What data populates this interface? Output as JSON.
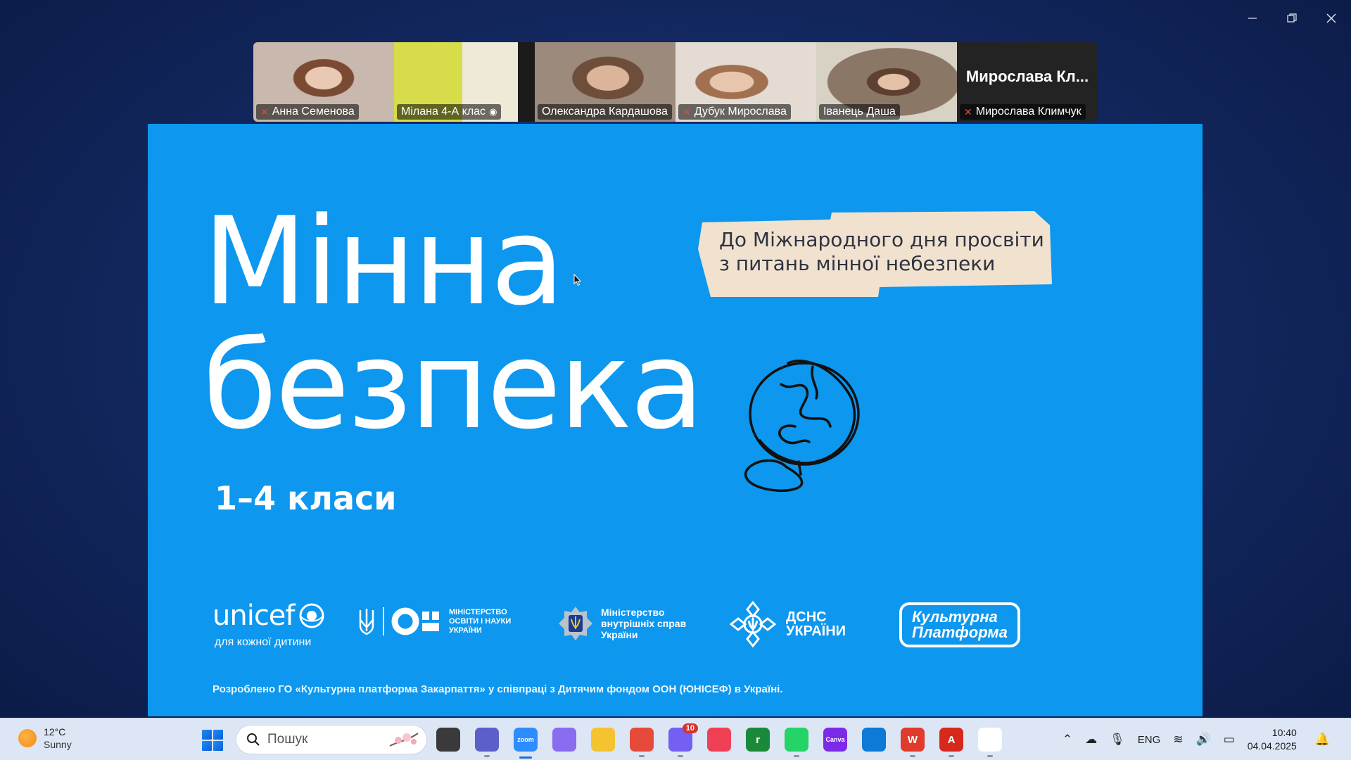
{
  "window": {
    "controls": [
      "minimize",
      "restore",
      "close"
    ]
  },
  "participants": [
    {
      "name": "Анна Семенова",
      "muted": true,
      "active": false,
      "bg": "#b9a89c"
    },
    {
      "name": "Мілана 4-А клас",
      "muted": false,
      "active": false,
      "bg": "#c7d048"
    },
    {
      "name": "Олександра Кардашова",
      "muted": false,
      "active": true,
      "bg": "#8c7466"
    },
    {
      "name": "Дубук Мирослава",
      "muted": true,
      "active": false,
      "bg": "#c9b8a8"
    },
    {
      "name": "Іванець Даша",
      "muted": false,
      "active": false,
      "bg": "#7e6a5a"
    },
    {
      "name": "Мирослава Климчук",
      "muted": true,
      "active": false,
      "display_name": "Мирослава  Кл...",
      "bg": "#232323"
    }
  ],
  "slide": {
    "title_line1": "Мінна",
    "title_line2": "безпека",
    "grades": "1–4 класи",
    "note": "До Міжнародного дня просвіти\nз питань мінної небезпеки",
    "note_line1": "До Міжнародного дня просвіти",
    "note_line2": "з питань мінної небезпеки",
    "logos": {
      "unicef": "unicef",
      "unicef_tagline": "для кожної дитини",
      "mon_line1": "Міністерство",
      "mon_line2": "освіти і науки",
      "mon_line3": "України",
      "mvs_line1": "Міністерство",
      "mvs_line2": "внутрішніх справ",
      "mvs_line3": "України",
      "dsns_line1": "ДСНС",
      "dsns_line2": "УКРАЇНИ",
      "kp_line1": "Культурна",
      "kp_line2": "Платформа"
    },
    "footer": "Розроблено ГО «Культурна платформа Закарпаття» у співпраці з Дитячим фондом ООН (ЮНІСЕФ) в Україні."
  },
  "taskbar": {
    "weather_temp": "12°C",
    "weather_cond": "Sunny",
    "search_placeholder": "Пошук",
    "apps": [
      {
        "name": "task-view",
        "color": "#3a3a3a",
        "label": ""
      },
      {
        "name": "teams-meet",
        "color": "#5b5fc7",
        "label": ""
      },
      {
        "name": "zoom",
        "color": "#2d8cff",
        "label": "zoom"
      },
      {
        "name": "copilot",
        "color": "#8a6cf0",
        "label": ""
      },
      {
        "name": "file-explorer",
        "color": "#f4c430",
        "label": ""
      },
      {
        "name": "chrome",
        "color": "#e64a3b",
        "label": ""
      },
      {
        "name": "viber",
        "color": "#7360f2",
        "label": "",
        "badge": "10"
      },
      {
        "name": "pocket",
        "color": "#ef4056",
        "label": ""
      },
      {
        "name": "rakuten",
        "color": "#1a8a3a",
        "label": "r"
      },
      {
        "name": "whatsapp",
        "color": "#25d366",
        "label": ""
      },
      {
        "name": "canva",
        "color": "#7d2ae8",
        "label": "Canva"
      },
      {
        "name": "edge",
        "color": "#0c7ad6",
        "label": ""
      },
      {
        "name": "wps-office",
        "color": "#e03b2c",
        "label": "W"
      },
      {
        "name": "acrobat",
        "color": "#d7281c",
        "label": "A"
      },
      {
        "name": "notepad",
        "color": "#2a6cd6",
        "label": ""
      }
    ],
    "language": "ENG",
    "time": "10:40",
    "date": "04.04.2025"
  }
}
